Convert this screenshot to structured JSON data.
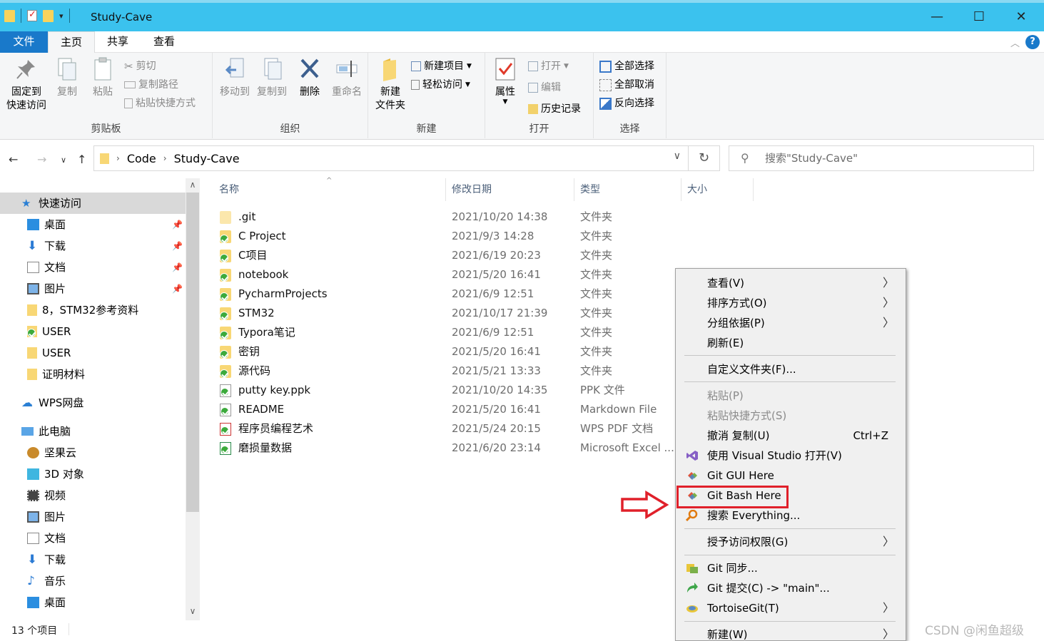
{
  "window": {
    "title": "Study-Cave"
  },
  "tabs": [
    "文件",
    "主页",
    "共享",
    "查看"
  ],
  "ribbon": {
    "clipboard": {
      "label": "剪贴板",
      "pin": "固定到\n快速访问",
      "copy": "复制",
      "paste": "粘贴",
      "cut": "剪切",
      "copy_path": "复制路径",
      "paste_shortcut": "粘贴快捷方式"
    },
    "organize": {
      "label": "组织",
      "move_to": "移动到",
      "copy_to": "复制到",
      "delete": "删除",
      "rename": "重命名"
    },
    "new": {
      "label": "新建",
      "new_folder": "新建\n文件夹",
      "new_item": "新建项目",
      "easy_access": "轻松访问"
    },
    "open": {
      "label": "打开",
      "properties": "属性",
      "open": "打开",
      "edit": "编辑",
      "history": "历史记录"
    },
    "select": {
      "label": "选择",
      "select_all": "全部选择",
      "select_none": "全部取消",
      "invert": "反向选择"
    }
  },
  "address": {
    "crumbs": [
      "Code",
      "Study-Cave"
    ],
    "search_placeholder": "搜索\"Study-Cave\""
  },
  "nav": {
    "quick_access": "快速访问",
    "quick_items": [
      "桌面",
      "下载",
      "文档",
      "图片",
      "8，STM32参考资料",
      "USER",
      "USER",
      "证明材料"
    ],
    "wps": "WPS网盘",
    "this_pc": "此电脑",
    "pc_items": [
      "坚果云",
      "3D 对象",
      "视频",
      "图片",
      "文档",
      "下载",
      "音乐",
      "桌面"
    ]
  },
  "columns": {
    "name": "名称",
    "date": "修改日期",
    "type": "类型",
    "size": "大小"
  },
  "files": [
    {
      "name": ".git",
      "date": "2021/10/20 14:38",
      "type": "文件夹"
    },
    {
      "name": "C Project",
      "date": "2021/9/3 14:28",
      "type": "文件夹"
    },
    {
      "name": "C项目",
      "date": "2021/6/19 20:23",
      "type": "文件夹"
    },
    {
      "name": "notebook",
      "date": "2021/5/20 16:41",
      "type": "文件夹"
    },
    {
      "name": "PycharmProjects",
      "date": "2021/6/9 12:51",
      "type": "文件夹"
    },
    {
      "name": "STM32",
      "date": "2021/10/17 21:39",
      "type": "文件夹"
    },
    {
      "name": "Typora笔记",
      "date": "2021/6/9 12:51",
      "type": "文件夹"
    },
    {
      "name": "密钥",
      "date": "2021/5/20 16:41",
      "type": "文件夹"
    },
    {
      "name": "源代码",
      "date": "2021/5/21 13:33",
      "type": "文件夹"
    },
    {
      "name": "putty key.ppk",
      "date": "2021/10/20 14:35",
      "type": "PPK 文件"
    },
    {
      "name": "README",
      "date": "2021/5/20 16:41",
      "type": "Markdown File"
    },
    {
      "name": "程序员编程艺术",
      "date": "2021/5/24 20:15",
      "type": "WPS PDF 文档"
    },
    {
      "name": "磨损量数据",
      "date": "2021/6/20 23:14",
      "type": "Microsoft Excel ..."
    }
  ],
  "status": "13 个项目",
  "context_menu": {
    "view": "查看(V)",
    "sort": "排序方式(O)",
    "group": "分组依据(P)",
    "refresh": "刷新(E)",
    "customize": "自定义文件夹(F)...",
    "paste": "粘贴(P)",
    "paste_shortcut": "粘贴快捷方式(S)",
    "undo": "撤消 复制(U)",
    "undo_shortcut": "Ctrl+Z",
    "vs": "使用 Visual Studio 打开(V)",
    "git_gui": "Git GUI Here",
    "git_bash": "Git Bash Here",
    "everything": "搜索 Everything...",
    "access": "授予访问权限(G)",
    "git_sync": "Git 同步...",
    "git_commit": "Git 提交(C) -> \"main\"...",
    "tortoise": "TortoiseGit(T)",
    "new": "新建(W)"
  },
  "watermark": "CSDN @闲鱼超级",
  "colors": {
    "titlebar": "#3bc2ee",
    "file_tab": "#1979ca",
    "highlight": "#e0202a"
  }
}
